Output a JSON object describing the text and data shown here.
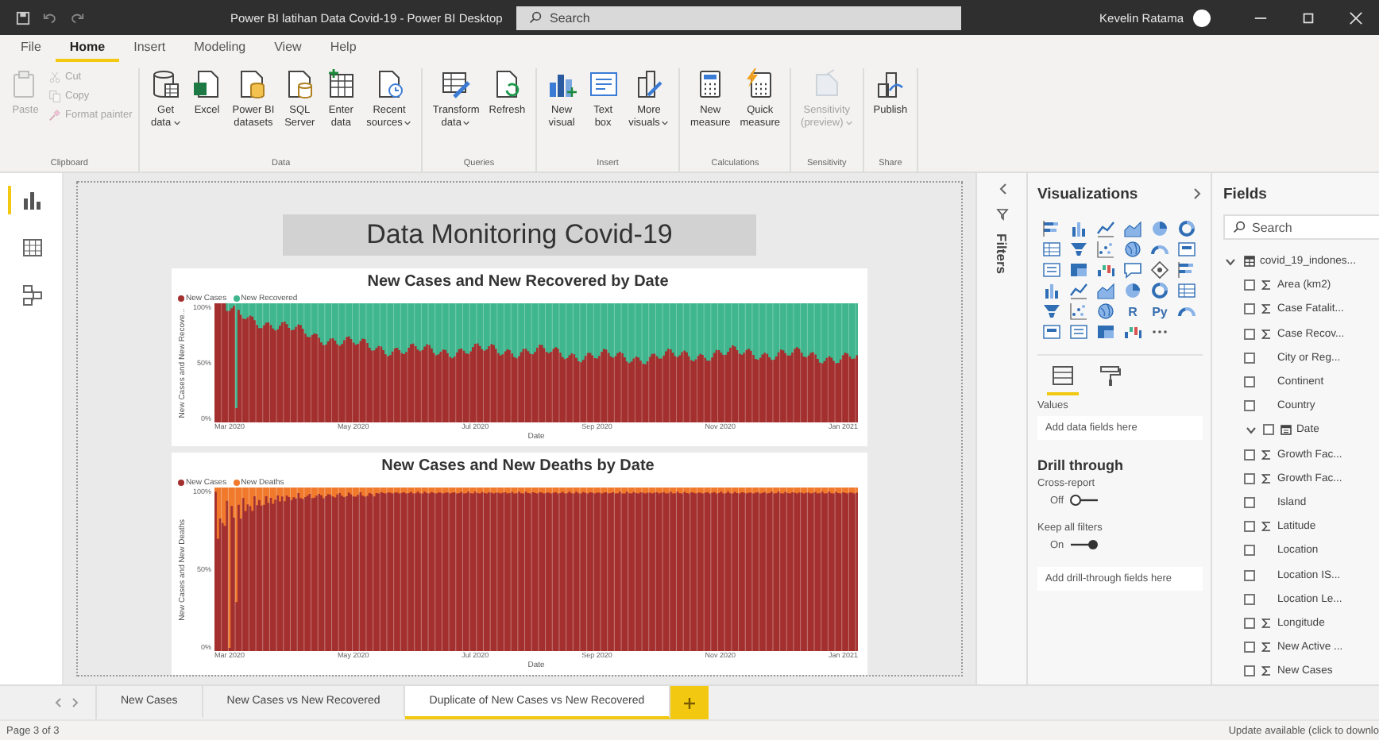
{
  "window": {
    "title": "Power BI latihan Data Covid-19 - Power BI Desktop",
    "search_placeholder": "Search",
    "user": "Kevelin Ratama"
  },
  "menu_tabs": [
    {
      "label": "File",
      "selected": false
    },
    {
      "label": "Home",
      "selected": true
    },
    {
      "label": "Insert",
      "selected": false
    },
    {
      "label": "Modeling",
      "selected": false
    },
    {
      "label": "View",
      "selected": false
    },
    {
      "label": "Help",
      "selected": false
    }
  ],
  "ribbon": [
    {
      "group": "Clipboard",
      "buttons": [
        {
          "kind": "large",
          "lines": [
            "Paste"
          ],
          "dropdown": false,
          "disabled": true
        },
        {
          "kind": "small",
          "lines": [
            "Cut"
          ],
          "dropdown": false,
          "disabled": true
        },
        {
          "kind": "small",
          "lines": [
            "Copy"
          ],
          "dropdown": false,
          "disabled": true
        },
        {
          "kind": "small",
          "lines": [
            "Format painter"
          ],
          "dropdown": false,
          "disabled": true
        }
      ]
    },
    {
      "group": "Data",
      "buttons": [
        {
          "kind": "large",
          "lines": [
            "Get",
            "data"
          ],
          "dropdown": true,
          "disabled": false
        },
        {
          "kind": "large",
          "lines": [
            "Excel"
          ],
          "dropdown": false,
          "disabled": false
        },
        {
          "kind": "large",
          "lines": [
            "Power BI",
            "datasets"
          ],
          "dropdown": false,
          "disabled": false
        },
        {
          "kind": "large",
          "lines": [
            "SQL",
            "Server"
          ],
          "dropdown": false,
          "disabled": false
        },
        {
          "kind": "large",
          "lines": [
            "Enter",
            "data"
          ],
          "dropdown": false,
          "disabled": false
        },
        {
          "kind": "large",
          "lines": [
            "Recent",
            "sources"
          ],
          "dropdown": true,
          "disabled": false
        }
      ]
    },
    {
      "group": "Queries",
      "buttons": [
        {
          "kind": "large",
          "lines": [
            "Transform",
            "data"
          ],
          "dropdown": true,
          "disabled": false
        },
        {
          "kind": "large",
          "lines": [
            "Refresh"
          ],
          "dropdown": false,
          "disabled": false
        }
      ]
    },
    {
      "group": "Insert",
      "buttons": [
        {
          "kind": "large",
          "lines": [
            "New",
            "visual"
          ],
          "dropdown": false,
          "disabled": false
        },
        {
          "kind": "large",
          "lines": [
            "Text",
            "box"
          ],
          "dropdown": false,
          "disabled": false
        },
        {
          "kind": "large",
          "lines": [
            "More",
            "visuals"
          ],
          "dropdown": true,
          "disabled": false
        }
      ]
    },
    {
      "group": "Calculations",
      "buttons": [
        {
          "kind": "large",
          "lines": [
            "New",
            "measure"
          ],
          "dropdown": false,
          "disabled": false
        },
        {
          "kind": "large",
          "lines": [
            "Quick",
            "measure"
          ],
          "dropdown": false,
          "disabled": false
        }
      ]
    },
    {
      "group": "Sensitivity",
      "buttons": [
        {
          "kind": "large",
          "lines": [
            "Sensitivity",
            "(preview)"
          ],
          "dropdown": true,
          "disabled": true
        }
      ]
    },
    {
      "group": "Share",
      "buttons": [
        {
          "kind": "large",
          "lines": [
            "Publish"
          ],
          "dropdown": false,
          "disabled": false
        }
      ]
    }
  ],
  "views": [
    {
      "selected": true
    },
    {
      "selected": false
    },
    {
      "selected": false
    }
  ],
  "report": {
    "title": "Data Monitoring Covid-19",
    "charts": [
      {
        "title": "New Cases and New Recovered by Date",
        "legend": [
          {
            "label": "New Cases",
            "color": "#a3302e"
          },
          {
            "label": "New Recovered",
            "color": "#3fb68e"
          }
        ],
        "ylabel": "New Cases and New Recove...",
        "yticks": [
          "100%",
          "50%",
          "0%"
        ],
        "xticks": [
          "Mar 2020",
          "May 2020",
          "Jul 2020",
          "Sep 2020",
          "Nov 2020",
          "Jan 2021"
        ],
        "xlabel": "Date"
      },
      {
        "title": "New Cases and New Deaths by Date",
        "legend": [
          {
            "label": "New Cases",
            "color": "#a3302e"
          },
          {
            "label": "New Deaths",
            "color": "#f0792c"
          }
        ],
        "ylabel": "New Cases and New Deaths",
        "yticks": [
          "100%",
          "50%",
          "0%"
        ],
        "xticks": [
          "Mar 2020",
          "May 2020",
          "Jul 2020",
          "Sep 2020",
          "Nov 2020",
          "Jan 2021"
        ],
        "xlabel": "Date"
      }
    ]
  },
  "filters": {
    "label": "Filters"
  },
  "visualizations": {
    "title": "Visualizations",
    "gallery_text": [
      "R",
      "Py"
    ],
    "pane_tabs": [
      {
        "selected": true
      },
      {
        "selected": false
      }
    ],
    "values_label": "Values",
    "values_placeholder": "Add data fields here",
    "drill": {
      "title": "Drill through",
      "toggles": [
        {
          "label": "Cross-report",
          "state": "Off",
          "on": false
        },
        {
          "label": "Keep all filters",
          "state": "On",
          "on": true
        }
      ],
      "placeholder": "Add drill-through fields here"
    }
  },
  "fields": {
    "title": "Fields",
    "search_placeholder": "Search",
    "tree": [
      {
        "name": "covid_19_indones...",
        "kind": "table",
        "expanded": true,
        "children": [
          {
            "name": "Area (km2)",
            "kind": "measure",
            "checked": false
          },
          {
            "name": "Case Fatalit...",
            "kind": "measure",
            "checked": false
          },
          {
            "name": "Case Recov...",
            "kind": "measure",
            "checked": false
          },
          {
            "name": "City or Reg...",
            "kind": "plain",
            "checked": false
          },
          {
            "name": "Continent",
            "kind": "plain",
            "checked": false
          },
          {
            "name": "Country",
            "kind": "plain",
            "checked": false
          },
          {
            "name": "Date",
            "kind": "date",
            "expanded": true,
            "checked": false
          },
          {
            "name": "Growth Fac...",
            "kind": "measure",
            "checked": false
          },
          {
            "name": "Growth Fac...",
            "kind": "measure",
            "checked": false
          },
          {
            "name": "Island",
            "kind": "plain",
            "checked": false
          },
          {
            "name": "Latitude",
            "kind": "measure",
            "checked": false
          },
          {
            "name": "Location",
            "kind": "plain",
            "checked": false
          },
          {
            "name": "Location IS...",
            "kind": "plain",
            "checked": false
          },
          {
            "name": "Location Le...",
            "kind": "plain",
            "checked": false
          },
          {
            "name": "Longitude",
            "kind": "measure",
            "checked": false
          },
          {
            "name": "New Active ...",
            "kind": "measure",
            "checked": false
          },
          {
            "name": "New Cases",
            "kind": "measure",
            "checked": false
          }
        ]
      }
    ]
  },
  "page_tabs": [
    {
      "label": "New Cases",
      "selected": false
    },
    {
      "label": "New Cases vs New Recovered",
      "selected": false
    },
    {
      "label": "Duplicate of New Cases vs New Recovered",
      "selected": true
    }
  ],
  "status": {
    "page": "Page 3 of 3",
    "update": "Update available (click to downlo"
  }
}
